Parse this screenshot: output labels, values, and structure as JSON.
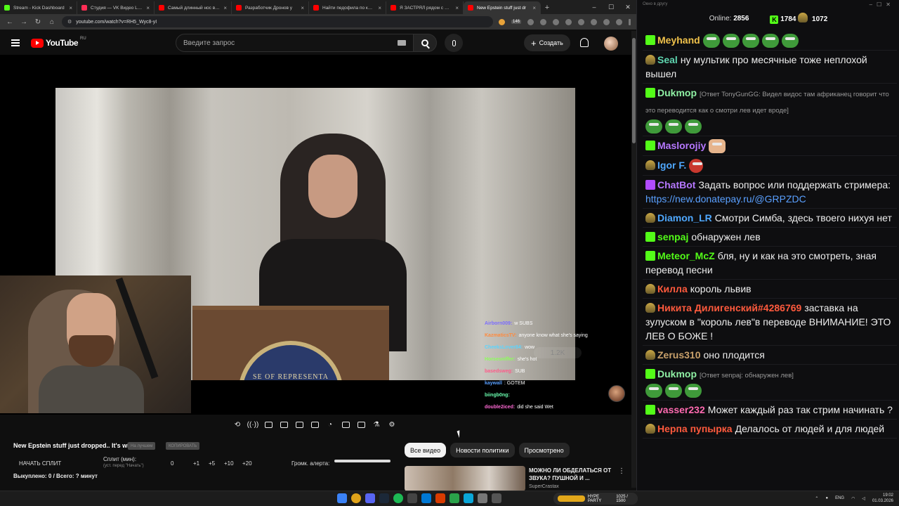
{
  "browser": {
    "tabs": [
      {
        "label": "Stream - Kick Dashboard",
        "color": "#53fc18"
      },
      {
        "label": "Студия — VK Видео Live",
        "color": "#ff2d55"
      },
      {
        "label": "Самый длинный нос в истории",
        "color": "#ff0000"
      },
      {
        "label": "Разработчик Дронов у",
        "color": "#ff0000"
      },
      {
        "label": "Найти педофила по кирпичу",
        "color": "#ff0000"
      },
      {
        "label": "Я ЗАСТРЯЛ рядом с Ираном",
        "color": "#ff0000"
      },
      {
        "label": "New Epstein stuff just dr",
        "color": "#ff0000",
        "active": true
      }
    ],
    "url": "youtube.com/watch?v=RH5_Wyc8-yI",
    "ext_badge": "146"
  },
  "youtube": {
    "logo_text": "YouTube",
    "region": "RU",
    "search_placeholder": "Введите запрос",
    "create_label": "Создать"
  },
  "overlay_chat": [
    {
      "user": "Airborn009:",
      "text": "w SUBS",
      "color": "#7b6cff"
    },
    {
      "user": "KazmaticsTV:",
      "text": "anyone know what she's saying",
      "color": "#ff8a3d"
    },
    {
      "user": "CheeksLover84:",
      "text": "wow",
      "color": "#5ad5ff"
    },
    {
      "user": "Horsesniffer:",
      "text": "she's hot",
      "color": "#8cff5a"
    },
    {
      "user": "basedsweg:",
      "text": "SUB",
      "color": "#ff5a8a"
    },
    {
      "user": "kaywall",
      "text": ": GOTEM",
      "color": "#5aa0ff"
    },
    {
      "user": "biingb0ng:",
      "text": "",
      "color": "#6affb0"
    },
    {
      "user": "double2iced:",
      "text": "did she said Wet",
      "color": "#ff6ad5"
    }
  ],
  "viewer_count": "1.2K",
  "below": {
    "title": "New Epstein stuff just dropped.. It's wild",
    "pill1": "На лучшем",
    "pill2": "КОПИРОВАТЬ",
    "start_split": "НАЧАТЬ СПЛИТ",
    "split_label": "Сплит (мин):",
    "split_hint": "(уст. перед \"Начать\")",
    "split_value": "0",
    "inc1": "+1",
    "inc2": "+5",
    "inc3": "+10",
    "inc4": "+20",
    "volume_label": "Громк. алерта:",
    "volume_level": 1.0,
    "bought": "Выкуплено: 0 / Всего: ? минут"
  },
  "chips": [
    "Все видео",
    "Новости политики",
    "Просмотрено"
  ],
  "recommendation": {
    "title": "МОЖНО ЛИ ОБДЕЛАТЬСЯ ОТ ЗВУКА? ПУШНОЙ И ...",
    "channel": "SuperCrastax"
  },
  "chat": {
    "window_title": "Окно в другу",
    "online_label": "Online:",
    "online": "2856",
    "kick_count": "1784",
    "drum_count": "1072",
    "messages": [
      {
        "badge": "k",
        "nick": "Meyhand",
        "color": "#f0c24b",
        "text": "",
        "emotes": 5
      },
      {
        "badge": "dr",
        "nick": "Seal",
        "color": "#5fd6b0",
        "text": "ну мультик про месячные тоже неплохой вышел"
      },
      {
        "badge": "k",
        "nick": "Dukmop",
        "color": "#8ff0a4",
        "reply": "[Ответ TonyGunGG: Видел видос там африканец говорит что это переводится как о смотри лев идет вроде]",
        "text": "",
        "emotes": 3
      },
      {
        "badge": "k",
        "nick": "Maslorojiy",
        "color": "#b678ff",
        "text": "",
        "emotes": 1,
        "emote_kind": "face"
      },
      {
        "badge": "dr",
        "nick": "Igor F.",
        "color": "#4fa8ff",
        "text": "",
        "emotes": 1,
        "emote_kind": "red"
      },
      {
        "badge": "px",
        "nick": "ChatBot",
        "color": "#b678ff",
        "text": "Задать вопрос или поддержать стримера:",
        "link": "https://new.donatepay.ru/@GRPZDC"
      },
      {
        "badge": "dr",
        "nick": "Diamon_LR",
        "color": "#4fa8ff",
        "text": "Смотри Симба, здесь твоего нихуя нет"
      },
      {
        "badge": "k",
        "nick": "senpaj",
        "color": "#53fc18",
        "text": "обнаружен лев"
      },
      {
        "badge": "k",
        "nick": "Meteor_McZ",
        "color": "#53fc18",
        "text": "бля, ну и как на это смотреть, зная перевод песни"
      },
      {
        "badge": "dr",
        "nick": "Килла",
        "color": "#ff5a3d",
        "text": "король львив"
      },
      {
        "badge": "dr",
        "nick": "Никита Дилигенский#4286769",
        "color": "#ff5a3d",
        "text": "заставка на зулуском в \"король лев\"в переводе ВНИМАНИЕ! ЭТО ЛЕВ О БОЖЕ !"
      },
      {
        "badge": "dr",
        "nick": "Zerus310",
        "color": "#c9a16b",
        "text": "оно плодится"
      },
      {
        "badge": "k",
        "nick": "Dukmop",
        "color": "#8ff0a4",
        "reply": "[Ответ senpaj: обнаружен лев]",
        "text": "",
        "emotes": 3
      },
      {
        "badge": "k",
        "nick": "vasser232",
        "color": "#ff6ab0",
        "text": "Может каждый раз так стрим начинать ?"
      },
      {
        "badge": "dr",
        "nick": "Нерпа пупырка",
        "color": "#ff5a3d",
        "text": "Делалось от людей и для людей"
      }
    ]
  },
  "taskbar": {
    "lang": "ENG",
    "time": "19:02",
    "date": "01.03.2026",
    "hype_text": "HYPE PARTY",
    "hype_count": "1025 / 1500"
  }
}
